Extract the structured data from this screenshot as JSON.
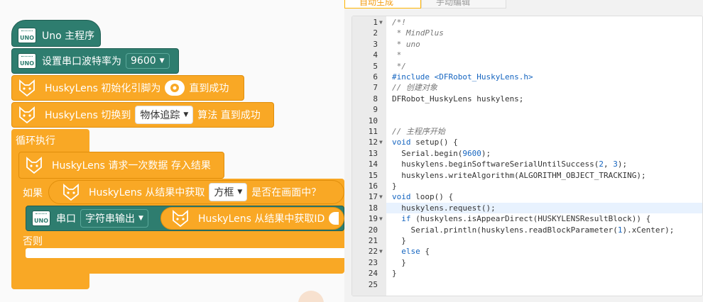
{
  "blocks": {
    "main_program": "Uno 主程序",
    "uno_icon_label": "UNO",
    "serial_baud": {
      "label": "设置串口波特率为",
      "value": "9600"
    },
    "husky_init": {
      "prefix": "HuskyLens 初始化引脚为",
      "suffix": "直到成功"
    },
    "husky_switch": {
      "prefix": "HuskyLens 切换到",
      "algorithm": "物体追踪",
      "suffix": "算法 直到成功"
    },
    "loop": "循环执行",
    "husky_request": "HuskyLens 请求一次数据 存入结果",
    "if_label": "如果",
    "husky_appear": {
      "prefix": "HuskyLens 从结果中获取",
      "target": "方框",
      "suffix": "是否在画面中？"
    },
    "serial_print": {
      "label": "串口",
      "mode": "字符串输出"
    },
    "husky_get_id": "HuskyLens 从结果中获取ID",
    "else_label": "否则"
  },
  "editor": {
    "tabs": [
      {
        "label": "自动生成",
        "active": true
      },
      {
        "label": "手动编辑",
        "active": false
      }
    ],
    "highlighted_line": 18,
    "lines": [
      {
        "n": "1",
        "fold": true,
        "text": "/*!"
      },
      {
        "n": "2",
        "fold": false,
        "text": " * MindPlus"
      },
      {
        "n": "3",
        "fold": false,
        "text": " * uno"
      },
      {
        "n": "4",
        "fold": false,
        "text": " *"
      },
      {
        "n": "5",
        "fold": false,
        "text": " */"
      },
      {
        "n": "6",
        "fold": false,
        "text": "#include <DFRobot_HuskyLens.h>"
      },
      {
        "n": "7",
        "fold": false,
        "text": "// 创建对象"
      },
      {
        "n": "8",
        "fold": false,
        "text": "DFRobot_HuskyLens huskylens;"
      },
      {
        "n": "9",
        "fold": false,
        "text": ""
      },
      {
        "n": "10",
        "fold": false,
        "text": ""
      },
      {
        "n": "11",
        "fold": false,
        "text": "// 主程序开始"
      },
      {
        "n": "12",
        "fold": true,
        "text": "void setup() {"
      },
      {
        "n": "13",
        "fold": false,
        "text": "  Serial.begin(9600);"
      },
      {
        "n": "14",
        "fold": false,
        "text": "  huskylens.beginSoftwareSerialUntilSuccess(2, 3);"
      },
      {
        "n": "15",
        "fold": false,
        "text": "  huskylens.writeAlgorithm(ALGORITHM_OBJECT_TRACKING);"
      },
      {
        "n": "16",
        "fold": false,
        "text": "}"
      },
      {
        "n": "17",
        "fold": true,
        "text": "void loop() {"
      },
      {
        "n": "18",
        "fold": false,
        "text": "  huskylens.request();"
      },
      {
        "n": "19",
        "fold": true,
        "text": "  if (huskylens.isAppearDirect(HUSKYLENSResultBlock)) {"
      },
      {
        "n": "20",
        "fold": false,
        "text": "    Serial.println(huskylens.readBlockParameter(1).xCenter);"
      },
      {
        "n": "21",
        "fold": false,
        "text": "  }"
      },
      {
        "n": "22",
        "fold": true,
        "text": "  else {"
      },
      {
        "n": "23",
        "fold": false,
        "text": "  }"
      },
      {
        "n": "24",
        "fold": false,
        "text": "}"
      },
      {
        "n": "25",
        "fold": false,
        "text": ""
      }
    ]
  },
  "colors": {
    "block_teal": "#2e7d6f",
    "block_orange": "#f9a825",
    "accent_tab": "#f39c12",
    "keyword": "#1565c0"
  }
}
